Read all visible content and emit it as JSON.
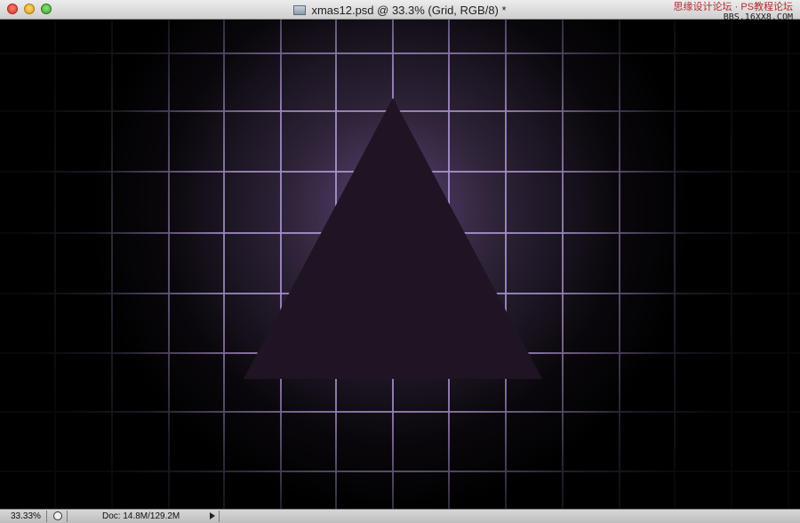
{
  "window": {
    "title": "xmas12.psd @ 33.3% (Grid, RGB/8) *",
    "watermark_line1": "思缘设计论坛 · PS教程论坛",
    "watermark_line2": "BBS.16XX8.COM"
  },
  "status": {
    "zoom": "33.33%",
    "doc_size": "Doc: 14.8M/129.2M"
  },
  "canvas": {
    "background": "#000000",
    "grid_color": "#b39ad6",
    "glow_color": "#5a4576",
    "triangle_color": "#1e1424"
  }
}
